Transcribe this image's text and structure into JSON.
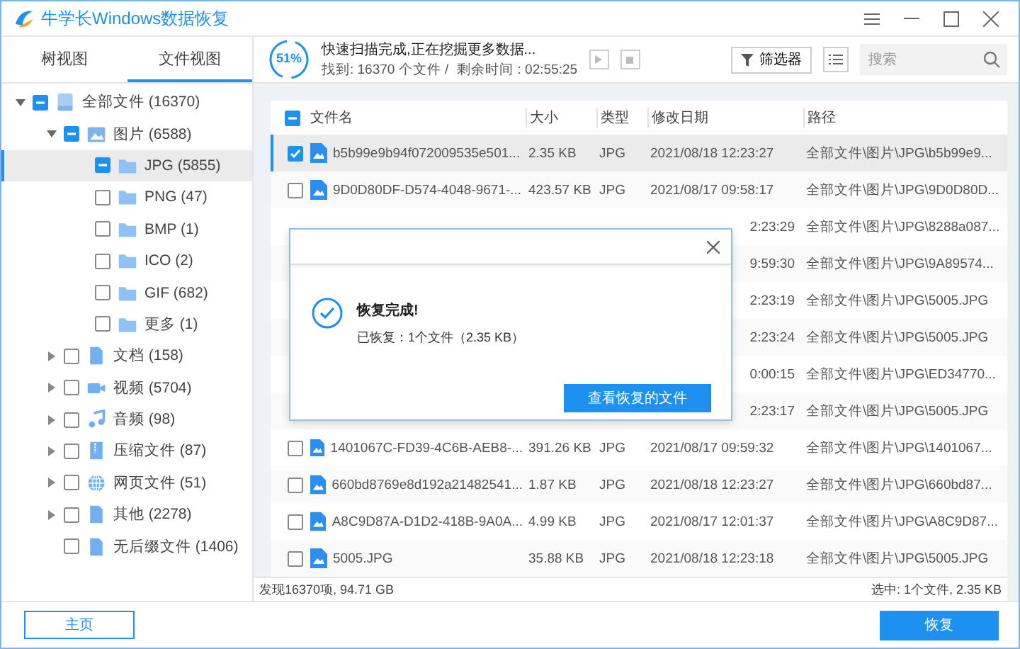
{
  "window": {
    "title": "牛学长Windows数据恢复"
  },
  "view_tabs": [
    {
      "label": "树视图",
      "selected": false
    },
    {
      "label": "文件视图",
      "selected": true
    }
  ],
  "tree": [
    {
      "label": "全部文件 (16370)",
      "kind": "drive",
      "checked": false,
      "partial": true,
      "expanded": true,
      "selected": false,
      "children": [
        {
          "label": "图片 (6588)",
          "kind": "image",
          "checked": false,
          "partial": true,
          "expanded": true,
          "selected": false,
          "children": [
            {
              "label": "JPG (5855)",
              "kind": "folder",
              "checked": false,
              "partial": true,
              "selected": true
            },
            {
              "label": "PNG (47)",
              "kind": "folder",
              "checked": false,
              "partial": false,
              "selected": false
            },
            {
              "label": "BMP (1)",
              "kind": "folder",
              "checked": false,
              "partial": false,
              "selected": false
            },
            {
              "label": "ICO (2)",
              "kind": "folder",
              "checked": false,
              "partial": false,
              "selected": false
            },
            {
              "label": "GIF (682)",
              "kind": "folder",
              "checked": false,
              "partial": false,
              "selected": false
            },
            {
              "label": "更多 (1)",
              "kind": "folder",
              "checked": false,
              "partial": false,
              "selected": false
            }
          ]
        },
        {
          "label": "文档 (158)",
          "kind": "document",
          "checked": false,
          "partial": false,
          "expanded": false,
          "selected": false
        },
        {
          "label": "视频 (5704)",
          "kind": "video",
          "checked": false,
          "partial": false,
          "expanded": false,
          "selected": false
        },
        {
          "label": "音频 (98)",
          "kind": "audio",
          "checked": false,
          "partial": false,
          "expanded": false,
          "selected": false
        },
        {
          "label": "压缩文件 (87)",
          "kind": "archive",
          "checked": false,
          "partial": false,
          "expanded": false,
          "selected": false
        },
        {
          "label": "网页文件 (51)",
          "kind": "web",
          "checked": false,
          "partial": false,
          "expanded": false,
          "selected": false
        },
        {
          "label": "其他 (2278)",
          "kind": "document",
          "checked": false,
          "partial": false,
          "expanded": false,
          "selected": false
        },
        {
          "label": "无后缀文件 (1406)",
          "kind": "document",
          "checked": false,
          "partial": false,
          "selected": false
        }
      ]
    }
  ],
  "scan": {
    "progress_label": "51%",
    "status": "快速扫描完成,正在挖掘更多数据...",
    "found": "找到: 16370 个文件 /",
    "remaining": "剩余时间 : 02:55:25"
  },
  "toolbar": {
    "filter": "筛选器",
    "search": {
      "placeholder": "搜索"
    }
  },
  "table": {
    "header_checked": false,
    "header_partial": true,
    "columns": [
      "文件名",
      "大小",
      "类型",
      "修改日期",
      "路径"
    ],
    "rows": [
      {
        "covered": false,
        "checked": true,
        "selected": true,
        "name": "b5b99e9b94f072009535e501...",
        "size": "2.35 KB",
        "type": "JPG",
        "date": "2021/08/18 12:23:27",
        "path": "全部文件\\图片\\JPG\\b5b99e9..."
      },
      {
        "covered": false,
        "checked": false,
        "selected": false,
        "name": "9D0D80DF-D574-4048-9671-...",
        "size": "423.57 KB",
        "type": "JPG",
        "date": "2021/08/17 09:58:17",
        "path": "全部文件\\图片\\JPG\\9D0D80D..."
      },
      {
        "covered": true,
        "date": "2:23:29",
        "path": "全部文件\\图片\\JPG\\8288a087..."
      },
      {
        "covered": true,
        "date": "9:59:30",
        "path": "全部文件\\图片\\JPG\\9A89574..."
      },
      {
        "covered": true,
        "date": "2:23:19",
        "path": "全部文件\\图片\\JPG\\5005.JPG"
      },
      {
        "covered": true,
        "date": "2:23:24",
        "path": "全部文件\\图片\\JPG\\5005.JPG"
      },
      {
        "covered": true,
        "date": "0:00:15",
        "path": "全部文件\\图片\\JPG\\ED34770..."
      },
      {
        "covered": true,
        "date": "2:23:17",
        "path": "全部文件\\图片\\JPG\\5005.JPG"
      },
      {
        "covered": false,
        "checked": false,
        "selected": false,
        "name": "1401067C-FD39-4C6B-AEB8-...",
        "size": "391.26 KB",
        "type": "JPG",
        "date": "2021/08/17 09:59:32",
        "path": "全部文件\\图片\\JPG\\1401067..."
      },
      {
        "covered": false,
        "checked": false,
        "selected": false,
        "name": "660bd8769e8d192a21482541...",
        "size": "1.87 KB",
        "type": "JPG",
        "date": "2021/08/18 12:23:27",
        "path": "全部文件\\图片\\JPG\\660bd87..."
      },
      {
        "covered": false,
        "checked": false,
        "selected": false,
        "name": "A8C9D87A-D1D2-418B-9A0A...",
        "size": "4.99 KB",
        "type": "JPG",
        "date": "2021/08/17 12:01:37",
        "path": "全部文件\\图片\\JPG\\A8C9D87..."
      },
      {
        "covered": false,
        "checked": false,
        "selected": false,
        "name": "5005.JPG",
        "size": "35.88 KB",
        "type": "JPG",
        "date": "2021/08/18 12:23:18",
        "path": "全部文件\\图片\\JPG\\5005.JPG"
      }
    ]
  },
  "status_bar": {
    "found": "发现16370项, 94.71 GB",
    "selected": "选中: 1个文件, 2.35 KB"
  },
  "buttons": {
    "home": "主页",
    "recover": "恢复"
  },
  "dialog": {
    "title": "恢复完成!",
    "detail": "已恢复：1个文件（2.35 KB）",
    "button": "查看恢复的文件"
  }
}
